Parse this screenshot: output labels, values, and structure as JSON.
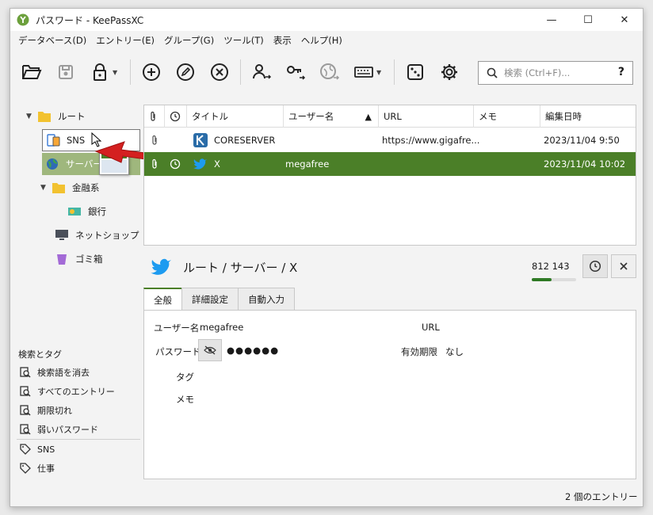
{
  "window": {
    "title": "パスワード - KeePassXC"
  },
  "menu": [
    "データベース(D)",
    "エントリー(E)",
    "グループ(G)",
    "ツール(T)",
    "表示",
    "ヘルプ(H)"
  ],
  "search": {
    "placeholder": "検索 (Ctrl+F)...",
    "help": "?"
  },
  "groups": [
    {
      "label": "ルート"
    },
    {
      "label": "SNS"
    },
    {
      "label": "サーバー"
    },
    {
      "label": "金融系"
    },
    {
      "label": "銀行"
    },
    {
      "label": "ネットショップ"
    },
    {
      "label": "ゴミ箱"
    }
  ],
  "search_tags": {
    "heading": "検索とタグ",
    "items": [
      "検索語を消去",
      "すべてのエントリー",
      "期限切れ",
      "弱いパスワード",
      "SNS",
      "仕事"
    ]
  },
  "entries": {
    "columns": [
      "タイトル",
      "ユーザー名",
      "URL",
      "メモ",
      "編集日時"
    ],
    "rows": [
      {
        "title": "CORESERVER",
        "username": "",
        "url": "https://www.gigafre...",
        "notes": "",
        "modified": "2023/11/04 9:50"
      },
      {
        "title": "X",
        "username": "megafree",
        "url": "",
        "notes": "",
        "modified": "2023/11/04 10:02"
      }
    ]
  },
  "detail": {
    "path": "ルート / サーバー / X",
    "score": "812 143",
    "score_fraction": 0.45,
    "tabs": [
      "全般",
      "詳細設定",
      "自動入力"
    ],
    "fields": {
      "username_label": "ユーザー名",
      "username": "megafree",
      "password_label": "パスワード",
      "password": "●●●●●●",
      "tags_label": "タグ",
      "notes_label": "メモ",
      "url_label": "URL",
      "expiry_label": "有効期限",
      "expiry": "なし"
    }
  },
  "status": {
    "count": "2 個のエントリー"
  },
  "colors": {
    "accent": "#4b7f28",
    "arrow": "#d42020",
    "folder": "#f2c230"
  }
}
